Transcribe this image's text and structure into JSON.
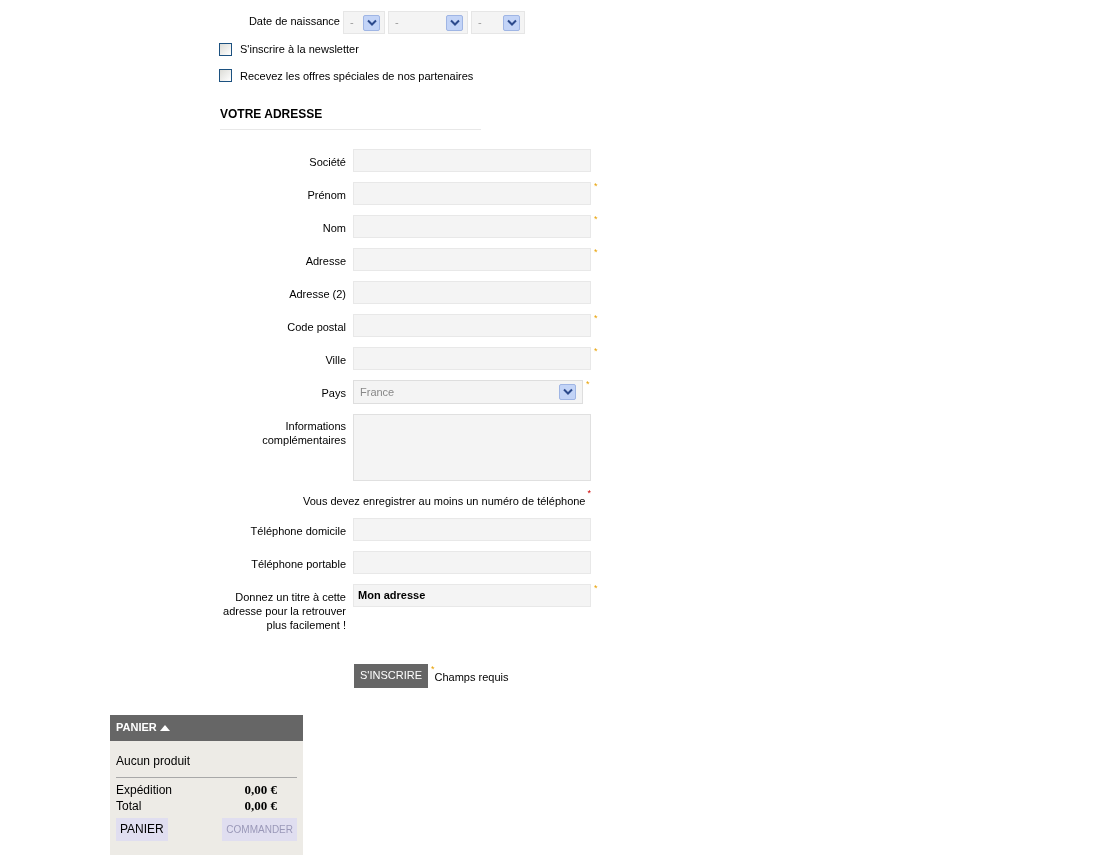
{
  "birthdate": {
    "label": "Date de naissance",
    "selects": [
      {
        "value": "-"
      },
      {
        "value": "-"
      },
      {
        "value": "-"
      }
    ]
  },
  "checkboxes": [
    {
      "label": "S'inscrire à la newsletter",
      "checked": false
    },
    {
      "label": "Recevez les offres spéciales de nos partenaires",
      "checked": false
    }
  ],
  "address": {
    "heading": "VOTRE ADRESSE",
    "fields": [
      {
        "kind": "text",
        "label": "Société",
        "required": false
      },
      {
        "kind": "text",
        "label": "Prénom",
        "required": true
      },
      {
        "kind": "text",
        "label": "Nom",
        "required": true
      },
      {
        "kind": "text",
        "label": "Adresse",
        "required": true
      },
      {
        "kind": "text",
        "label": "Adresse (2)",
        "required": false
      },
      {
        "kind": "text",
        "label": "Code postal",
        "required": true
      },
      {
        "kind": "text",
        "label": "Ville",
        "required": true
      },
      {
        "kind": "select",
        "label": "Pays",
        "value": "France",
        "required": true
      },
      {
        "kind": "textarea",
        "label": "Informations complémentaires",
        "required": false
      },
      {
        "kind": "note",
        "label": "Vous devez enregistrer au moins un numéro de téléphone",
        "required": true
      },
      {
        "kind": "text",
        "label": "Téléphone domicile",
        "required": false
      },
      {
        "kind": "text",
        "label": "Téléphone portable",
        "required": false
      },
      {
        "kind": "text",
        "label": "Donnez un titre à cette adresse pour la retrouver plus facilement !",
        "value": "Mon adresse",
        "required": true
      }
    ]
  },
  "required_mark": "*",
  "submit": {
    "label": "S'INSCRIRE",
    "legend": "Champs requis"
  },
  "cart": {
    "title": "PANIER",
    "expanded": true,
    "empty_message": "Aucun produit",
    "rows": [
      {
        "label": "Expédition",
        "value": "0,00 €"
      },
      {
        "label": "Total",
        "value": "0,00 €"
      }
    ],
    "buttons": [
      {
        "label": "PANIER",
        "disabled": false
      },
      {
        "label": "COMMANDER",
        "disabled": true
      }
    ]
  }
}
